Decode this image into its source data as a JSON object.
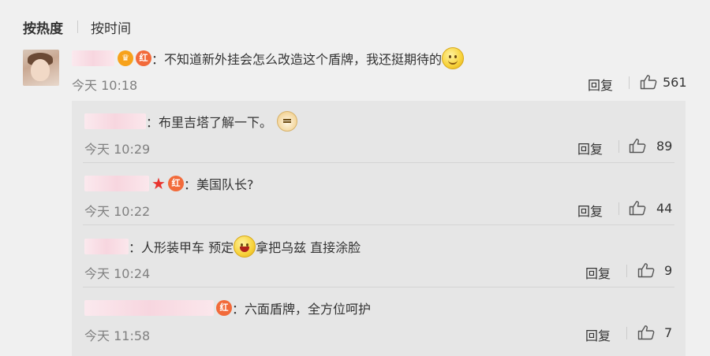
{
  "sort": {
    "by_heat": "按热度",
    "by_time": "按时间"
  },
  "main_comment": {
    "text": "：不知道新外挂会怎么改造这个盾牌，我还挺期待的",
    "badge": "红",
    "time": "今天 10:18",
    "reply_label": "回复",
    "likes": "561"
  },
  "replies": [
    {
      "text": "：布里吉塔了解一下。",
      "time": "今天 10:29",
      "reply_label": "回复",
      "likes": "89",
      "icon": "doge-emoji-icon"
    },
    {
      "text": "：美国队长?",
      "badge": "红",
      "time": "今天 10:22",
      "reply_label": "回复",
      "likes": "44"
    },
    {
      "text_a": "：人形装甲车 预定",
      "text_b": " 拿把乌兹 直接涂脸",
      "time": "今天 10:24",
      "reply_label": "回复",
      "likes": "9",
      "icon": "laugh-emoji-icon"
    },
    {
      "text": "：六面盾牌，全方位呵护",
      "badge": "红",
      "time": "今天 11:58",
      "reply_label": "回复",
      "likes": "7"
    }
  ],
  "colors": {
    "background": "#f0f0f0",
    "reply_box": "#e6e6e6",
    "time": "#808080",
    "badge": "#f26a3a",
    "star": "#e8342e"
  }
}
